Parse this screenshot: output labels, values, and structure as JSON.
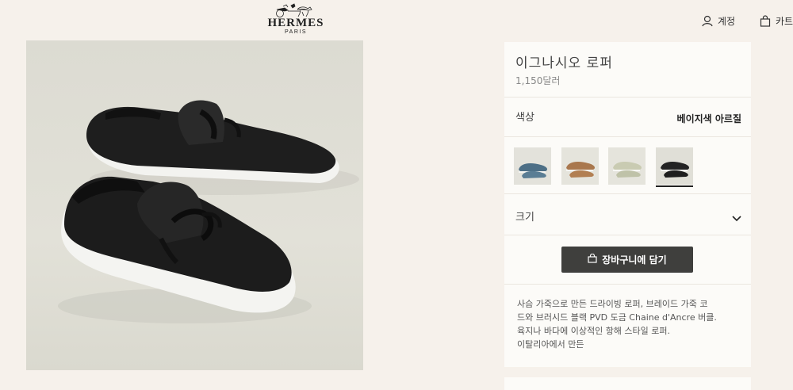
{
  "header": {
    "brand_name": "HERMES",
    "brand_sub": "PARIS",
    "account_label": "계정",
    "cart_label": "카트"
  },
  "product": {
    "title": "이그나시오 로퍼",
    "price": "1,150달러",
    "color_label": "색상",
    "color_value": "베이지색 아르질",
    "swatches": [
      {
        "name": "blue",
        "color": "#4d6f86"
      },
      {
        "name": "tan",
        "color": "#a9774d"
      },
      {
        "name": "sage",
        "color": "#c9cbb2"
      },
      {
        "name": "black",
        "color": "#232323",
        "selected": true
      }
    ],
    "size_label": "크기",
    "add_to_cart_label": "장바구니에 담기",
    "description": [
      "사슴 가죽으로 만든 드라이빙 로퍼, 브레이드 가죽 코",
      "드와 브러시드 블랙 PVD 도금 Chaine d'Ancre 버클.",
      "육지나 바다에 이상적인 항해 스타일 로퍼.",
      "이탈리아에서 만든"
    ]
  },
  "icons": {
    "account": "user-icon",
    "cart": "shopping-bag-icon",
    "size": "chevron-down-icon",
    "cart_button": "shopping-bag-icon"
  }
}
